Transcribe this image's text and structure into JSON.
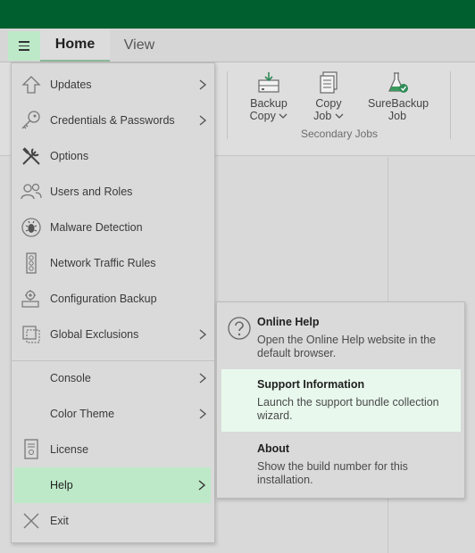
{
  "tabs": [
    {
      "label": "Home"
    },
    {
      "label": "View"
    }
  ],
  "ribbon": {
    "buttons": [
      {
        "line1": "Backup",
        "line2": "Copy",
        "icon": "backup-copy-icon",
        "has_dropdown": true
      },
      {
        "line1": "Copy",
        "line2": "Job",
        "icon": "copy-job-icon",
        "has_dropdown": true
      },
      {
        "line1": "SureBackup",
        "line2": "Job",
        "icon": "surebackup-flask-icon",
        "has_dropdown": false
      }
    ],
    "group_label": "Secondary Jobs"
  },
  "menu": {
    "items": [
      {
        "label": "Updates",
        "icon": "upload-arrow-icon",
        "submenu": true
      },
      {
        "label": "Credentials & Passwords",
        "icon": "key-icon",
        "submenu": true
      },
      {
        "label": "Options",
        "icon": "tools-icon",
        "submenu": false
      },
      {
        "label": "Users and Roles",
        "icon": "users-icon",
        "submenu": false
      },
      {
        "label": "Malware Detection",
        "icon": "bug-icon",
        "submenu": false
      },
      {
        "label": "Network Traffic Rules",
        "icon": "traffic-light-icon",
        "submenu": false
      },
      {
        "label": "Configuration Backup",
        "icon": "config-backup-icon",
        "submenu": false
      },
      {
        "label": "Global Exclusions",
        "icon": "exclusions-icon",
        "submenu": true
      },
      {
        "label": "Console",
        "icon": "",
        "submenu": true
      },
      {
        "label": "Color Theme",
        "icon": "",
        "submenu": true
      },
      {
        "label": "License",
        "icon": "license-icon",
        "submenu": false
      },
      {
        "label": "Help",
        "icon": "",
        "submenu": true,
        "active": true
      },
      {
        "label": "Exit",
        "icon": "close-x-icon",
        "submenu": false
      }
    ]
  },
  "help_submenu": {
    "items": [
      {
        "title": "Online Help",
        "description": "Open the Online Help website in the default browser.",
        "icon": "question-circle-icon"
      },
      {
        "title": "Support Information",
        "description": "Launch the support bundle collection wizard.",
        "active": true
      },
      {
        "title": "About",
        "description": "Show the build number for this installation."
      }
    ]
  },
  "colors": {
    "titlebar": "#005f2e",
    "highlight": "#bde9c8",
    "submenu_highlight": "#e8f8ed",
    "menu_bg": "#dadada"
  }
}
